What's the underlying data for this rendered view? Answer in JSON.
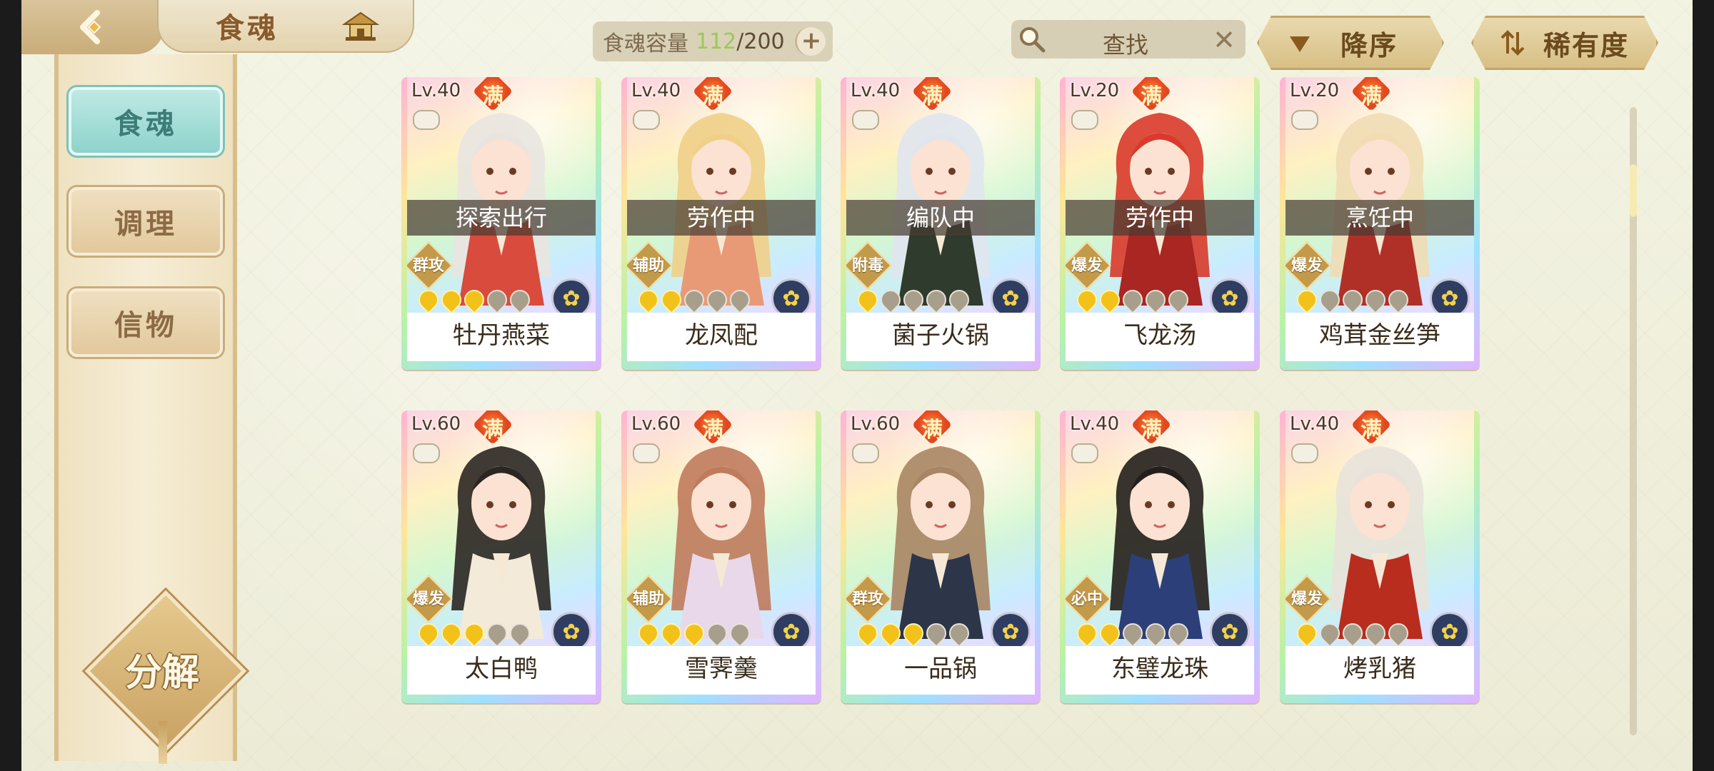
{
  "header": {
    "title": "食魂",
    "capacity_label": "食魂容量",
    "capacity_current": "112",
    "capacity_max": "/200",
    "capacity_add": "+",
    "search_placeholder": "查找",
    "search_clear": "✕",
    "sort_order_label": "降序",
    "sort_key_label": "稀有度"
  },
  "sidebar": {
    "items": [
      {
        "label": "食魂",
        "active": true
      },
      {
        "label": "调理",
        "active": false
      },
      {
        "label": "信物",
        "active": false
      }
    ],
    "decompose_label": "分解"
  },
  "full_badge": "满",
  "cards": [
    {
      "level": "Lv.40",
      "status": "探索出行",
      "role": "群攻",
      "stars": 3,
      "name": "牡丹燕菜",
      "hair": "#e9e4e0",
      "robe": "#d94b3c"
    },
    {
      "level": "Lv.40",
      "status": "劳作中",
      "role": "辅助",
      "stars": 2,
      "name": "龙凤配",
      "hair": "#f0cf88",
      "robe": "#e89a77"
    },
    {
      "level": "Lv.40",
      "status": "编队中",
      "role": "附毒",
      "stars": 1,
      "name": "菌子火锅",
      "hair": "#e0e6ee",
      "robe": "#2f3b2c"
    },
    {
      "level": "Lv.20",
      "status": "劳作中",
      "role": "爆发",
      "stars": 2,
      "name": "飞龙汤",
      "hair": "#d93a2b",
      "robe": "#a92622"
    },
    {
      "level": "Lv.20",
      "status": "烹饪中",
      "role": "爆发",
      "stars": 1,
      "name": "鸡茸金丝笋",
      "hair": "#f1dcb4",
      "robe": "#b03028"
    },
    {
      "level": "Lv.60",
      "status": "",
      "role": "爆发",
      "stars": 3,
      "name": "太白鸭",
      "hair": "#2b2622",
      "robe": "#f3ead9"
    },
    {
      "level": "Lv.60",
      "status": "",
      "role": "辅助",
      "stars": 3,
      "name": "雪霁羹",
      "hair": "#c07a5c",
      "robe": "#e9d8ea"
    },
    {
      "level": "Lv.60",
      "status": "",
      "role": "群攻",
      "stars": 3,
      "name": "一品锅",
      "hair": "#a88564",
      "robe": "#2d3548"
    },
    {
      "level": "Lv.40",
      "status": "",
      "role": "必中",
      "stars": 2,
      "name": "东璧龙珠",
      "hair": "#241e1c",
      "robe": "#2c3f78"
    },
    {
      "level": "Lv.40",
      "status": "",
      "role": "爆发",
      "stars": 1,
      "name": "烤乳猪",
      "hair": "#e8e2da",
      "robe": "#b92d1f"
    }
  ]
}
